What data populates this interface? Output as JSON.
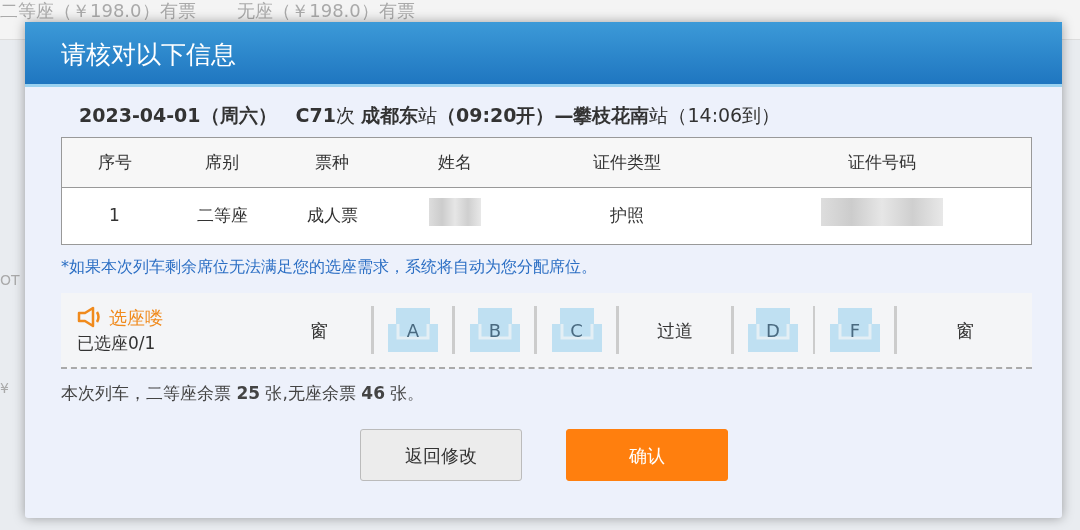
{
  "background": {
    "top_text": "二等座（￥198.0）有票　　 无座（￥198.0）有票",
    "side_texts": [
      "OT",
      "¥"
    ]
  },
  "dialog": {
    "title": "请核对以下信息",
    "trip": "**2023-04-01（周六）　C71**次 **成都东**站**（09:20开）—攀枝花南**站（14:06到）",
    "table": {
      "columns": [
        "序号",
        "席别",
        "票种",
        "姓名",
        "证件类型",
        "证件号码"
      ],
      "rows": [
        {
          "cells": [
            "1",
            "二等座",
            "成人票",
            null,
            "护照",
            null
          ]
        }
      ]
    },
    "notice": "*如果本次列车剩余席位无法满足您的选座需求，系统将自动为您分配席位。",
    "seat_picker": {
      "title": "选座喽",
      "status": "已选座0/1",
      "items": [
        {
          "kind": "label",
          "text": "窗"
        },
        {
          "kind": "seat",
          "text": "A",
          "selected": false
        },
        {
          "kind": "seat",
          "text": "B",
          "selected": false
        },
        {
          "kind": "seat",
          "text": "C",
          "selected": false
        },
        {
          "kind": "label",
          "text": "过道"
        },
        {
          "kind": "seat",
          "text": "D",
          "selected": false
        },
        {
          "kind": "seat",
          "text": "F",
          "selected": false
        },
        {
          "kind": "label",
          "text": "窗"
        }
      ]
    },
    "remaining": "本次列车，二等座余票 **25** 张,无座余票 **46** 张。",
    "buttons": [
      {
        "kind": "secondary",
        "label": "返回修改"
      },
      {
        "kind": "primary",
        "label": "确认"
      }
    ]
  }
}
